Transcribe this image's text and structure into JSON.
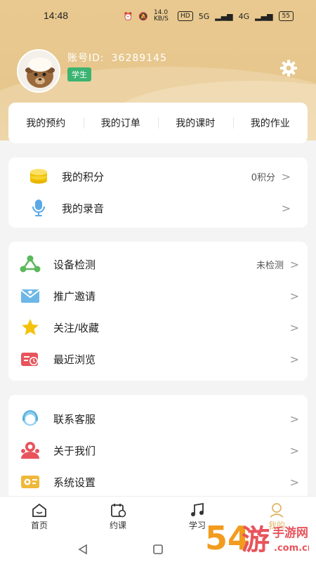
{
  "status_bar": {
    "time": "14:48",
    "network_speed": "14.0 KB/S",
    "hd_label": "HD",
    "signal1": "5G",
    "signal2": "4G",
    "battery": "55"
  },
  "profile": {
    "account_label": "账号ID:",
    "account_id": "36289145",
    "role": "学生",
    "settings_icon": "gear-icon"
  },
  "tabs": [
    "我的预约",
    "我的订单",
    "我的课时",
    "我的作业"
  ],
  "group1": [
    {
      "label": "我的积分",
      "value": "0积分",
      "icon": "coins-icon"
    },
    {
      "label": "我的录音",
      "value": "",
      "icon": "microphone-icon"
    }
  ],
  "group2": [
    {
      "label": "设备检测",
      "value": "未检测",
      "icon": "device-check-icon"
    },
    {
      "label": "推广邀请",
      "value": "",
      "icon": "invite-mail-icon"
    },
    {
      "label": "关注/收藏",
      "value": "",
      "icon": "star-icon"
    },
    {
      "label": "最近浏览",
      "value": "",
      "icon": "recent-history-icon"
    }
  ],
  "group3": [
    {
      "label": "联系客服",
      "value": "",
      "icon": "customer-service-icon"
    },
    {
      "label": "关于我们",
      "value": "",
      "icon": "about-us-icon"
    },
    {
      "label": "系统设置",
      "value": "",
      "icon": "system-settings-icon"
    }
  ],
  "chevron": ">",
  "bottom_nav": [
    {
      "label": "首页",
      "icon": "home-icon"
    },
    {
      "label": "约课",
      "icon": "calendar-icon"
    },
    {
      "label": "学习",
      "icon": "music-note-icon"
    },
    {
      "label": "我的",
      "icon": "profile-icon",
      "active": true
    }
  ],
  "watermark": {
    "line1": "54游",
    "line2": "手游网",
    "line3": ".com.cn"
  },
  "colors": {
    "header": "#e9c98f",
    "accent": "#e0b76a",
    "badge": "#3cb371"
  }
}
